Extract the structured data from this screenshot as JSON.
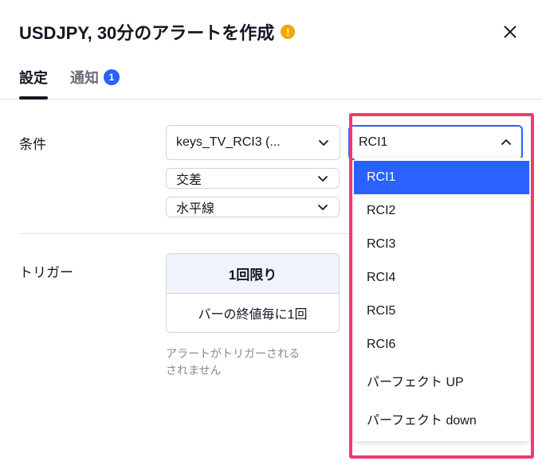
{
  "header": {
    "title": "USDJPY, 30分のアラートを作成"
  },
  "tabs": {
    "settings": "設定",
    "notify": "通知",
    "notify_badge": "1"
  },
  "rows": {
    "condition_label": "条件",
    "trigger_label": "トリガー"
  },
  "condition": {
    "indicator": "keys_TV_RCI3 (...",
    "line_select": "RCI1",
    "cross": "交差",
    "hline": "水平線"
  },
  "trigger": {
    "mode": "1回限り",
    "timing": "バーの終値毎に1回",
    "hint_line1": "アラートがトリガーされる",
    "hint_line2": "されません"
  },
  "dropdown": {
    "options": [
      "RCI1",
      "RCI2",
      "RCI3",
      "RCI4",
      "RCI5",
      "RCI6",
      "パーフェクト UP",
      "パーフェクト down"
    ],
    "selected_index": 0
  }
}
